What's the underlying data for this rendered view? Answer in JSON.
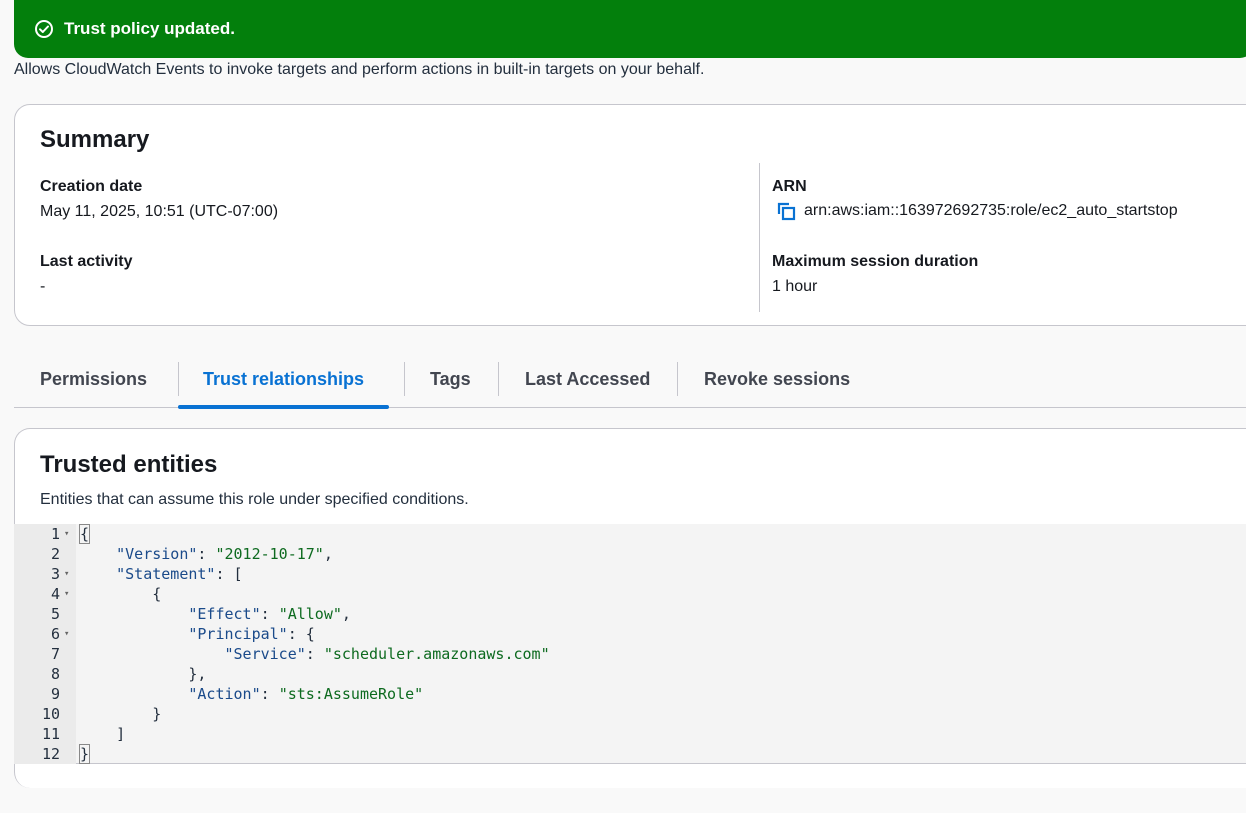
{
  "flash": {
    "message": "Trust policy updated."
  },
  "role_description": "Allows CloudWatch Events to invoke targets and perform actions in built-in targets on your behalf.",
  "summary": {
    "title": "Summary",
    "creation_date_label": "Creation date",
    "creation_date": "May 11, 2025, 10:51 (UTC-07:00)",
    "last_activity_label": "Last activity",
    "last_activity": "-",
    "arn_label": "ARN",
    "arn": "arn:aws:iam::163972692735:role/ec2_auto_startstop",
    "max_session_label": "Maximum session duration",
    "max_session": "1 hour"
  },
  "tabs": [
    {
      "label": "Permissions",
      "active": false
    },
    {
      "label": "Trust relationships",
      "active": true
    },
    {
      "label": "Tags",
      "active": false
    },
    {
      "label": "Last Accessed",
      "active": false
    },
    {
      "label": "Revoke sessions",
      "active": false
    }
  ],
  "trusted": {
    "title": "Trusted entities",
    "subtitle": "Entities that can assume this role under specified conditions."
  },
  "policy_lines": [
    {
      "n": "1",
      "fold": true,
      "text": "{"
    },
    {
      "n": "2",
      "fold": false,
      "text": "    \"Version\": \"2012-10-17\","
    },
    {
      "n": "3",
      "fold": true,
      "text": "    \"Statement\": ["
    },
    {
      "n": "4",
      "fold": true,
      "text": "        {"
    },
    {
      "n": "5",
      "fold": false,
      "text": "            \"Effect\": \"Allow\","
    },
    {
      "n": "6",
      "fold": true,
      "text": "            \"Principal\": {"
    },
    {
      "n": "7",
      "fold": false,
      "text": "                \"Service\": \"scheduler.amazonaws.com\""
    },
    {
      "n": "8",
      "fold": false,
      "text": "            },"
    },
    {
      "n": "9",
      "fold": false,
      "text": "            \"Action\": \"sts:AssumeRole\""
    },
    {
      "n": "10",
      "fold": false,
      "text": "        }"
    },
    {
      "n": "11",
      "fold": false,
      "text": "    ]"
    },
    {
      "n": "12",
      "fold": false,
      "text": "}"
    }
  ],
  "colors": {
    "success": "#037f0c",
    "accent": "#0972d3"
  }
}
